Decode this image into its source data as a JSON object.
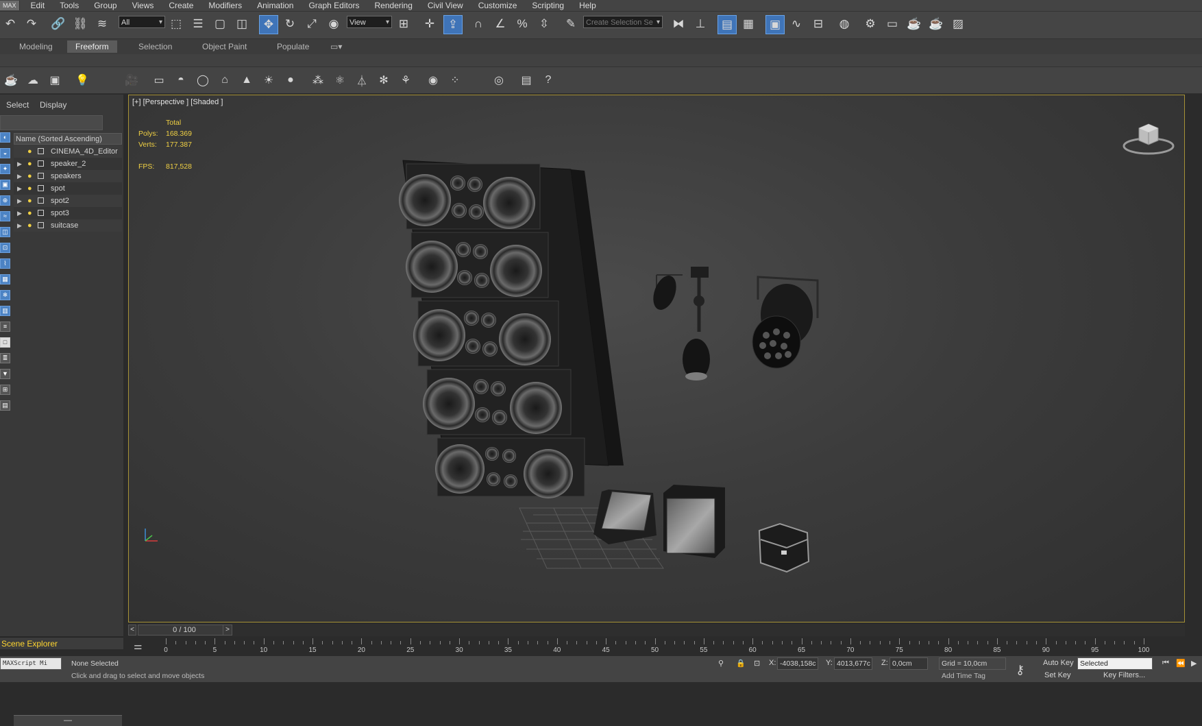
{
  "menubar": {
    "logo": "MAX",
    "items": [
      "Edit",
      "Tools",
      "Group",
      "Views",
      "Create",
      "Modifiers",
      "Animation",
      "Graph Editors",
      "Rendering",
      "Civil View",
      "Customize",
      "Scripting",
      "Help"
    ]
  },
  "toolbar": {
    "selection_filter": "All",
    "ref_coord": "View",
    "named_selection_placeholder": "Create Selection Se"
  },
  "ribbon": {
    "tabs": [
      "Modeling",
      "Freeform",
      "Selection",
      "Object Paint",
      "Populate"
    ],
    "active_tab": "Freeform"
  },
  "scene_explorer": {
    "menu": [
      "Select",
      "Display"
    ],
    "column_header": "Name (Sorted Ascending)",
    "items": [
      {
        "name": "CINEMA_4D_Editor",
        "type": "camera",
        "expandable": false
      },
      {
        "name": "speaker_2",
        "type": "object",
        "expandable": true
      },
      {
        "name": "speakers",
        "type": "object",
        "expandable": true
      },
      {
        "name": "spot",
        "type": "object",
        "expandable": true
      },
      {
        "name": "spot2",
        "type": "object",
        "expandable": true
      },
      {
        "name": "spot3",
        "type": "object",
        "expandable": true
      },
      {
        "name": "suitcase",
        "type": "object",
        "expandable": true
      }
    ],
    "title": "Scene Explorer"
  },
  "viewport": {
    "label": "[+] [Perspective ] [Shaded ]",
    "stats": {
      "total_label": "Total",
      "polys_label": "Polys:",
      "polys": "168.369",
      "verts_label": "Verts:",
      "verts": "177.387",
      "fps_label": "FPS:",
      "fps": "817,528"
    }
  },
  "timeline": {
    "frame_display": "0 / 100",
    "prev": "<",
    "next": ">",
    "labels": [
      "0",
      "5",
      "10",
      "15",
      "20",
      "25",
      "30",
      "35",
      "40",
      "45",
      "50",
      "55",
      "60",
      "65",
      "70",
      "75",
      "80",
      "85",
      "90",
      "95",
      "100"
    ]
  },
  "status": {
    "selection": "None Selected",
    "prompt": "Click and drag to select and move objects",
    "script_label": "MAXScript Mi",
    "x_label": "X:",
    "x": "-4038,158c",
    "y_label": "Y:",
    "y": "4013,677c",
    "z_label": "Z:",
    "z": "0,0cm",
    "grid": "Grid = 10,0cm",
    "add_time_tag": "Add Time Tag",
    "auto_key": "Auto Key",
    "auto_key_mode": "Selected",
    "set_key": "Set Key",
    "key_filters": "Key Filters..."
  },
  "colors": {
    "accent": "#3f74b8",
    "viewport_border": "#a79236",
    "stats_text": "#f1d144"
  }
}
